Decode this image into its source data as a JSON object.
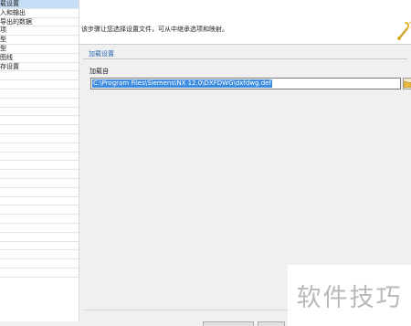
{
  "sidebar": {
    "items": [
      {
        "label": "载设置",
        "selected": true
      },
      {
        "label": "入和输出",
        "selected": false
      },
      {
        "label": "导出的数据",
        "selected": false
      },
      {
        "label": "项",
        "selected": false
      },
      {
        "label": "型",
        "selected": false
      },
      {
        "label": "型",
        "selected": false
      },
      {
        "label": "图线",
        "selected": false
      },
      {
        "label": "存设置",
        "selected": false
      }
    ],
    "empty_rows": 23
  },
  "header": {
    "description": "该步骤让您选择设置文件，可从中继承选项和映射。"
  },
  "main": {
    "section_title": "加载设置",
    "field_label": "加载自",
    "path_value": "C:\\Program Files\\Siemens\\NX 12.0\\DXFDWG\\dxfdwg.def"
  },
  "watermark": {
    "text": "软件技巧"
  },
  "colors": {
    "accent": "#1f5fa8",
    "selection": "#3c8de0",
    "panel": "#f0f0f0"
  }
}
